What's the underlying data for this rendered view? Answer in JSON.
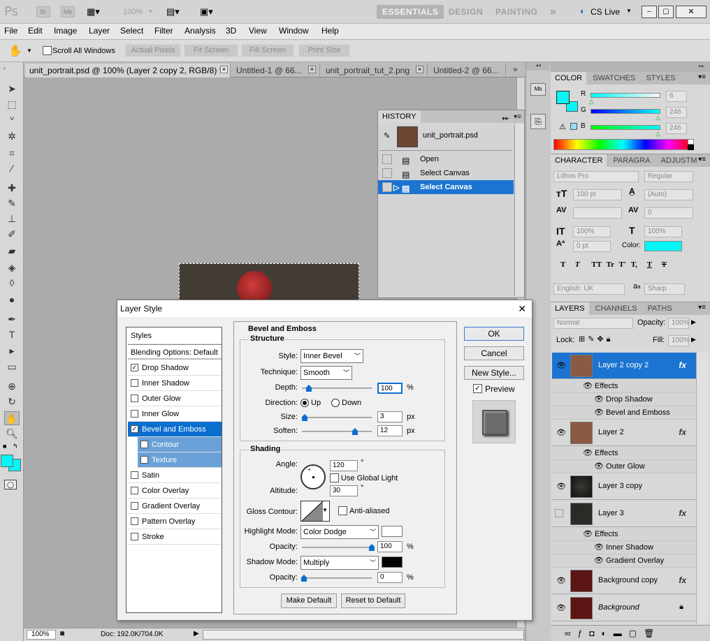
{
  "app": {
    "logo": "Ps",
    "bridge": "Br",
    "minibridge": "Mb",
    "zoom": "100%",
    "workspaces": [
      "ESSENTIALS",
      "DESIGN",
      "PAINTING"
    ],
    "more": "»",
    "cs_live": "CS Live"
  },
  "menu": [
    "File",
    "Edit",
    "Image",
    "Layer",
    "Select",
    "Filter",
    "Analysis",
    "3D",
    "View",
    "Window",
    "Help"
  ],
  "options": {
    "scroll_all": "Scroll All Windows",
    "actual_pixels": "Actual Pixels",
    "fit_screen": "Fit Screen",
    "fill_screen": "Fill Screen",
    "print_size": "Print Size"
  },
  "tabs": [
    "unit_portrait.psd @ 100% (Layer 2 copy 2, RGB/8) *",
    "Untitled-1 @ 66...",
    "unit_portrait_tut_2.png",
    "Untitled-2 @ 66..."
  ],
  "status": {
    "zoom": "100%",
    "doc": "Doc: 192.0K/704.0K"
  },
  "history": {
    "tab": "HISTORY",
    "snapshot": "unit_portrait.psd",
    "items": [
      "Open",
      "Select Canvas",
      "Select Canvas"
    ]
  },
  "color_panel": {
    "tabs": [
      "COLOR",
      "SWATCHES",
      "STYLES"
    ],
    "r_label": "R",
    "g_label": "G",
    "b_label": "B",
    "r": "6",
    "g": "246",
    "b": "246",
    "fg_color": "#06f6f6"
  },
  "character": {
    "tabs": [
      "CHARACTER",
      "PARAGRA",
      "ADJUSTM"
    ],
    "font": "Lithos Pro",
    "style": "Regular",
    "size": "100 pt",
    "leading": "(Auto)",
    "tracking": "0",
    "vscale": "100%",
    "hscale": "100%",
    "baseline": "0 pt",
    "color_label": "Color:",
    "language": "English: UK",
    "aa_glyph": "a",
    "aa": "Sharp",
    "type_buttons": [
      "T",
      "T",
      "TT",
      "Tr",
      "T'",
      "T,",
      "T",
      "T"
    ]
  },
  "layers": {
    "tabs": [
      "LAYERS",
      "CHANNELS",
      "PATHS"
    ],
    "blend": "Normal",
    "opacity_label": "Opacity:",
    "opacity": "100%",
    "lock_label": "Lock:",
    "fill_label": "Fill:",
    "fill": "100%",
    "fx": "fx",
    "items": [
      {
        "name": "Layer 2 copy 2",
        "effects": [
          "Drop Shadow",
          "Bevel and Emboss"
        ]
      },
      {
        "name": "Layer 2",
        "effects": [
          "Outer Glow"
        ]
      },
      {
        "name": "Layer 3 copy",
        "effects": []
      },
      {
        "name": "Layer 3",
        "effects": [
          "Inner Shadow",
          "Gradient Overlay"
        ]
      },
      {
        "name": "Background copy",
        "effects": []
      },
      {
        "name": "Background",
        "effects": []
      }
    ],
    "effects_label": "Effects"
  },
  "dialog": {
    "title": "Layer Style",
    "close": "✕",
    "styles": [
      {
        "label": "Styles",
        "checkbox": false,
        "checked": false
      },
      {
        "label": "Blending Options: Default",
        "checkbox": false,
        "checked": false
      },
      {
        "label": "Drop Shadow",
        "checkbox": true,
        "checked": true
      },
      {
        "label": "Inner Shadow",
        "checkbox": true,
        "checked": false
      },
      {
        "label": "Outer Glow",
        "checkbox": true,
        "checked": false
      },
      {
        "label": "Inner Glow",
        "checkbox": true,
        "checked": false
      },
      {
        "label": "Bevel and Emboss",
        "checkbox": true,
        "checked": true
      },
      {
        "label": "Contour",
        "checkbox": true,
        "checked": false
      },
      {
        "label": "Texture",
        "checkbox": true,
        "checked": false
      },
      {
        "label": "Satin",
        "checkbox": true,
        "checked": false
      },
      {
        "label": "Color Overlay",
        "checkbox": true,
        "checked": false
      },
      {
        "label": "Gradient Overlay",
        "checkbox": true,
        "checked": false
      },
      {
        "label": "Pattern Overlay",
        "checkbox": true,
        "checked": false
      },
      {
        "label": "Stroke",
        "checkbox": true,
        "checked": false
      }
    ],
    "section_title": "Bevel and Emboss",
    "structure": {
      "title": "Structure",
      "style_label": "Style:",
      "style": "Inner Bevel",
      "technique_label": "Technique:",
      "technique": "Smooth",
      "depth_label": "Depth:",
      "depth": "100",
      "depth_unit": "%",
      "direction_label": "Direction:",
      "up": "Up",
      "down": "Down",
      "size_label": "Size:",
      "size": "3",
      "size_unit": "px",
      "soften_label": "Soften:",
      "soften": "12",
      "soften_unit": "px"
    },
    "shading": {
      "title": "Shading",
      "angle_label": "Angle:",
      "angle": "120",
      "deg": "°",
      "global_light": "Use Global Light",
      "altitude_label": "Altitude:",
      "altitude": "30",
      "gloss_label": "Gloss Contour:",
      "anti_aliased": "Anti-aliased",
      "highlight_label": "Highlight Mode:",
      "highlight_mode": "Color Dodge",
      "highlight_color": "#ffffff",
      "h_opacity_label": "Opacity:",
      "h_opacity": "100",
      "pct": "%",
      "shadow_label": "Shadow Mode:",
      "shadow_mode": "Multiply",
      "shadow_color": "#000000",
      "s_opacity_label": "Opacity:",
      "s_opacity": "0"
    },
    "make_default": "Make Default",
    "reset_default": "Reset to Default",
    "ok": "OK",
    "cancel": "Cancel",
    "new_style": "New Style...",
    "preview": "Preview"
  }
}
